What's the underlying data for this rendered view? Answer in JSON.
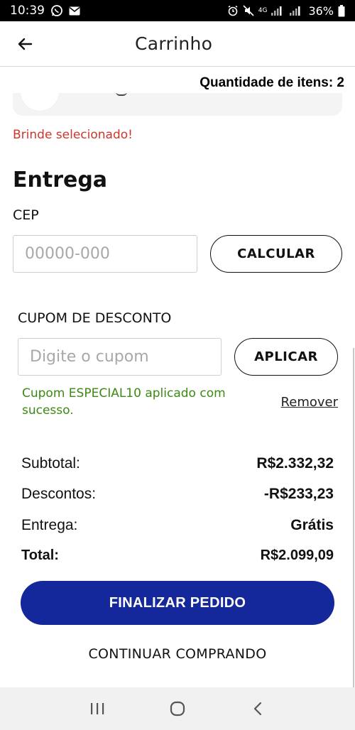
{
  "status_bar": {
    "time": "10:39",
    "battery": "36%",
    "network": "4G"
  },
  "app_bar": {
    "title": "Carrinho"
  },
  "cart": {
    "quantity_label": "Quantidade de itens: 2",
    "gift_message": "Brinde selecionado!"
  },
  "delivery": {
    "title": "Entrega",
    "cep_label": "CEP",
    "cep_placeholder": "00000-000",
    "calculate_label": "CALCULAR"
  },
  "coupon": {
    "label": "CUPOM DE DESCONTO",
    "placeholder": "Digite o cupom",
    "apply_label": "APLICAR",
    "success_message": "Cupom ESPECIAL10 aplicado com sucesso.",
    "remove_label": "Remover"
  },
  "summary": {
    "subtotal_label": "Subtotal:",
    "subtotal_value": "R$2.332,32",
    "discount_label": "Descontos:",
    "discount_value": "-R$233,23",
    "shipping_label": "Entrega:",
    "shipping_value": "Grátis",
    "total_label": "Total:",
    "total_value": "R$2.099,09"
  },
  "actions": {
    "finalize_label": "FINALIZAR PEDIDO",
    "continue_label": "CONTINUAR COMPRANDO"
  },
  "colors": {
    "primary": "#14289b",
    "error": "#d0352b",
    "success": "#3b8a12"
  },
  "icons": {
    "back": "arrow-left-icon",
    "nav_recent": "recent-apps-icon",
    "nav_home": "home-icon",
    "nav_back": "chevron-left-icon"
  }
}
